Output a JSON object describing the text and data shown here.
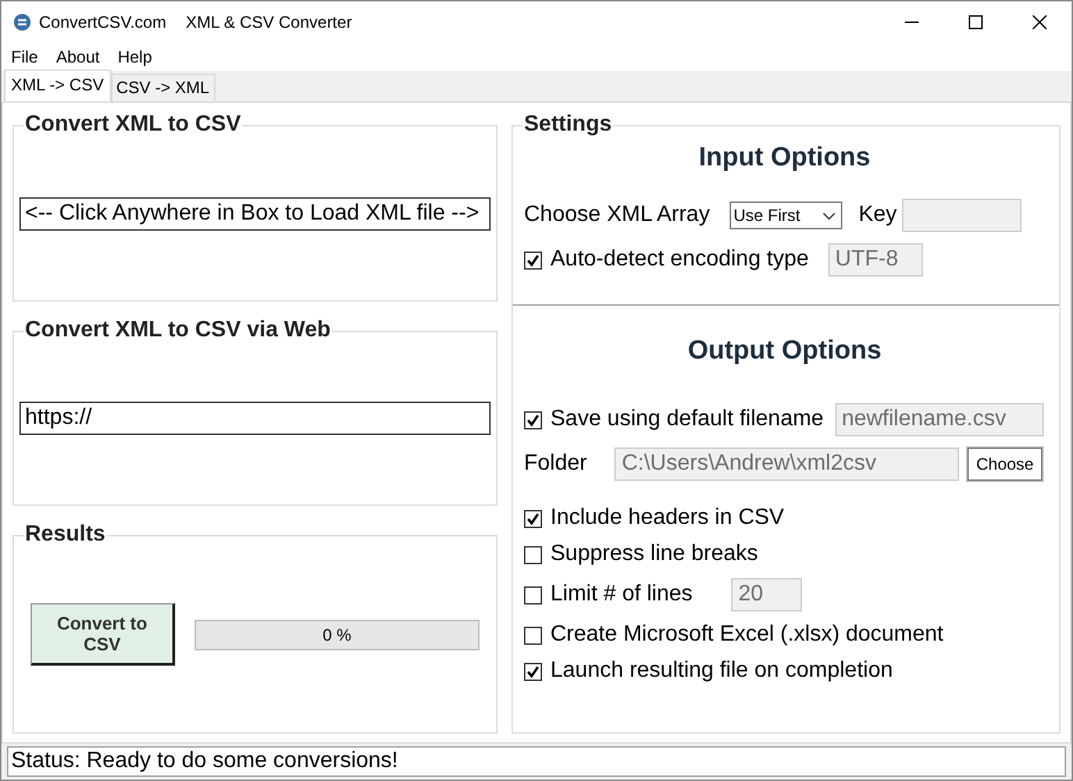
{
  "title_bar": {
    "app_name": "ConvertCSV.com",
    "title": "XML & CSV Converter"
  },
  "menu": [
    "File",
    "About",
    "Help"
  ],
  "tabs": [
    {
      "label": "XML -> CSV",
      "selected": true
    },
    {
      "label": "CSV -> XML",
      "selected": false
    }
  ],
  "load_group": {
    "title": "Convert XML to CSV",
    "load_button": "<-- Click Anywhere in Box to Load XML file -->"
  },
  "web_group": {
    "title": "Convert XML to CSV via Web",
    "url_field": {
      "value": "https://"
    }
  },
  "results": {
    "title": "Results",
    "convert_button": "Convert to CSV",
    "progress": {
      "level": 0,
      "reading": "0 %"
    }
  },
  "settings": {
    "title": "Settings",
    "input_heading": "Input Options",
    "array_label": "Choose XML Array",
    "array_select": "Use First",
    "key_label": "Key",
    "auto_detect": {
      "label": "Auto-detect encoding type",
      "checked": true,
      "value": "UTF-8"
    },
    "output_heading": "Output Options",
    "save_default": {
      "label": "Save using default filename",
      "checked": true,
      "value": "newfilename.csv"
    },
    "folder": {
      "label": "Folder",
      "value": "C:\\Users\\Andrew\\xml2csv"
    },
    "choose_button": "Choose",
    "options": [
      {
        "label": "Include headers in CSV",
        "checked": true
      },
      {
        "label": "Suppress line breaks",
        "checked": false
      },
      {
        "label": "Limit # of lines",
        "checked": false,
        "value": "20"
      },
      {
        "label": "Create Microsoft Excel (.xlsx) document",
        "checked": false
      },
      {
        "label": "Launch resulting file on completion",
        "checked": true
      }
    ]
  },
  "status_bar": "Status: Ready to do some conversions!"
}
